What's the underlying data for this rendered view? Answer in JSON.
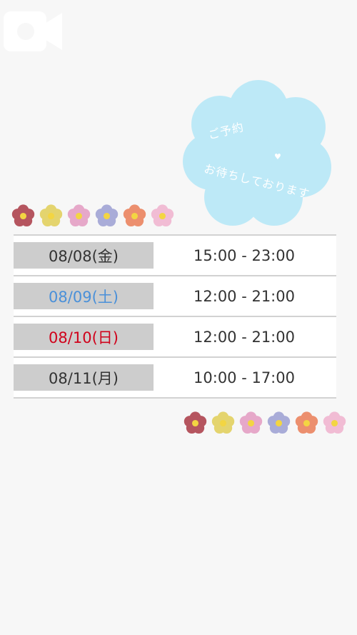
{
  "icons": {
    "video": "video-camera-icon"
  },
  "cloud": {
    "line1": "ご予約",
    "line2": "お待ちしております",
    "heart": "♥",
    "color": "#bde9f7"
  },
  "flowers": [
    {
      "petal": "#b5555f",
      "center": "#f3d542"
    },
    {
      "petal": "#e4d46e",
      "center": "#f3d542"
    },
    {
      "petal": "#e6a8c9",
      "center": "#f3d542"
    },
    {
      "petal": "#a9acd8",
      "center": "#f3d542"
    },
    {
      "petal": "#ec8f6e",
      "center": "#f3d542"
    },
    {
      "petal": "#f1bcd4",
      "center": "#f3d542"
    }
  ],
  "schedule": [
    {
      "date": "08/08(金)",
      "time": "15:00 - 23:00",
      "date_color": "#333333"
    },
    {
      "date": "08/09(土)",
      "time": "12:00 - 21:00",
      "date_color": "#4a90d9"
    },
    {
      "date": "08/10(日)",
      "time": "12:00 - 21:00",
      "date_color": "#d0021b"
    },
    {
      "date": "08/11(月)",
      "time": "10:00 - 17:00",
      "date_color": "#333333"
    }
  ]
}
